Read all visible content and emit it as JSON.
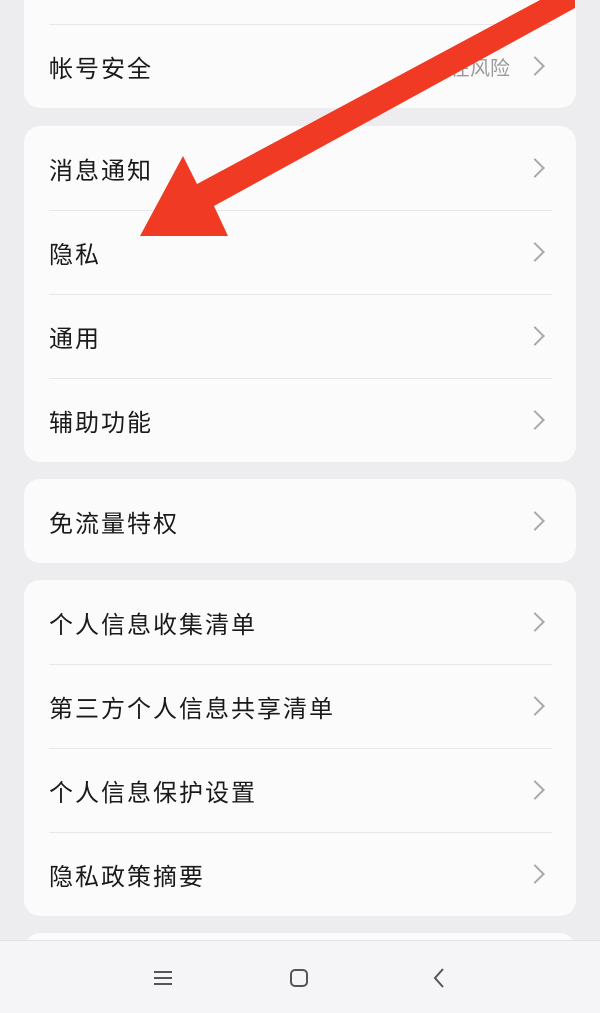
{
  "account_group": {
    "items": [
      {
        "label": "",
        "value": ""
      },
      {
        "label": "帐号安全",
        "value": "存在风险"
      }
    ]
  },
  "settings_group": {
    "items": [
      {
        "label": "消息通知"
      },
      {
        "label": "隐私"
      },
      {
        "label": "通用"
      },
      {
        "label": "辅助功能"
      }
    ]
  },
  "data_group": {
    "items": [
      {
        "label": "免流量特权"
      }
    ]
  },
  "privacy_group": {
    "items": [
      {
        "label": "个人信息收集清单"
      },
      {
        "label": "第三方个人信息共享清单"
      },
      {
        "label": "个人信息保护设置"
      },
      {
        "label": "隐私政策摘要"
      }
    ]
  },
  "nav": {
    "icons": [
      "menu-icon",
      "home-square-icon",
      "back-chevron-icon"
    ]
  },
  "colors": {
    "background": "#ededf0",
    "card": "#fbfbfb",
    "annotation_arrow": "#f03a24",
    "secondary_text": "#9a9a9a"
  }
}
